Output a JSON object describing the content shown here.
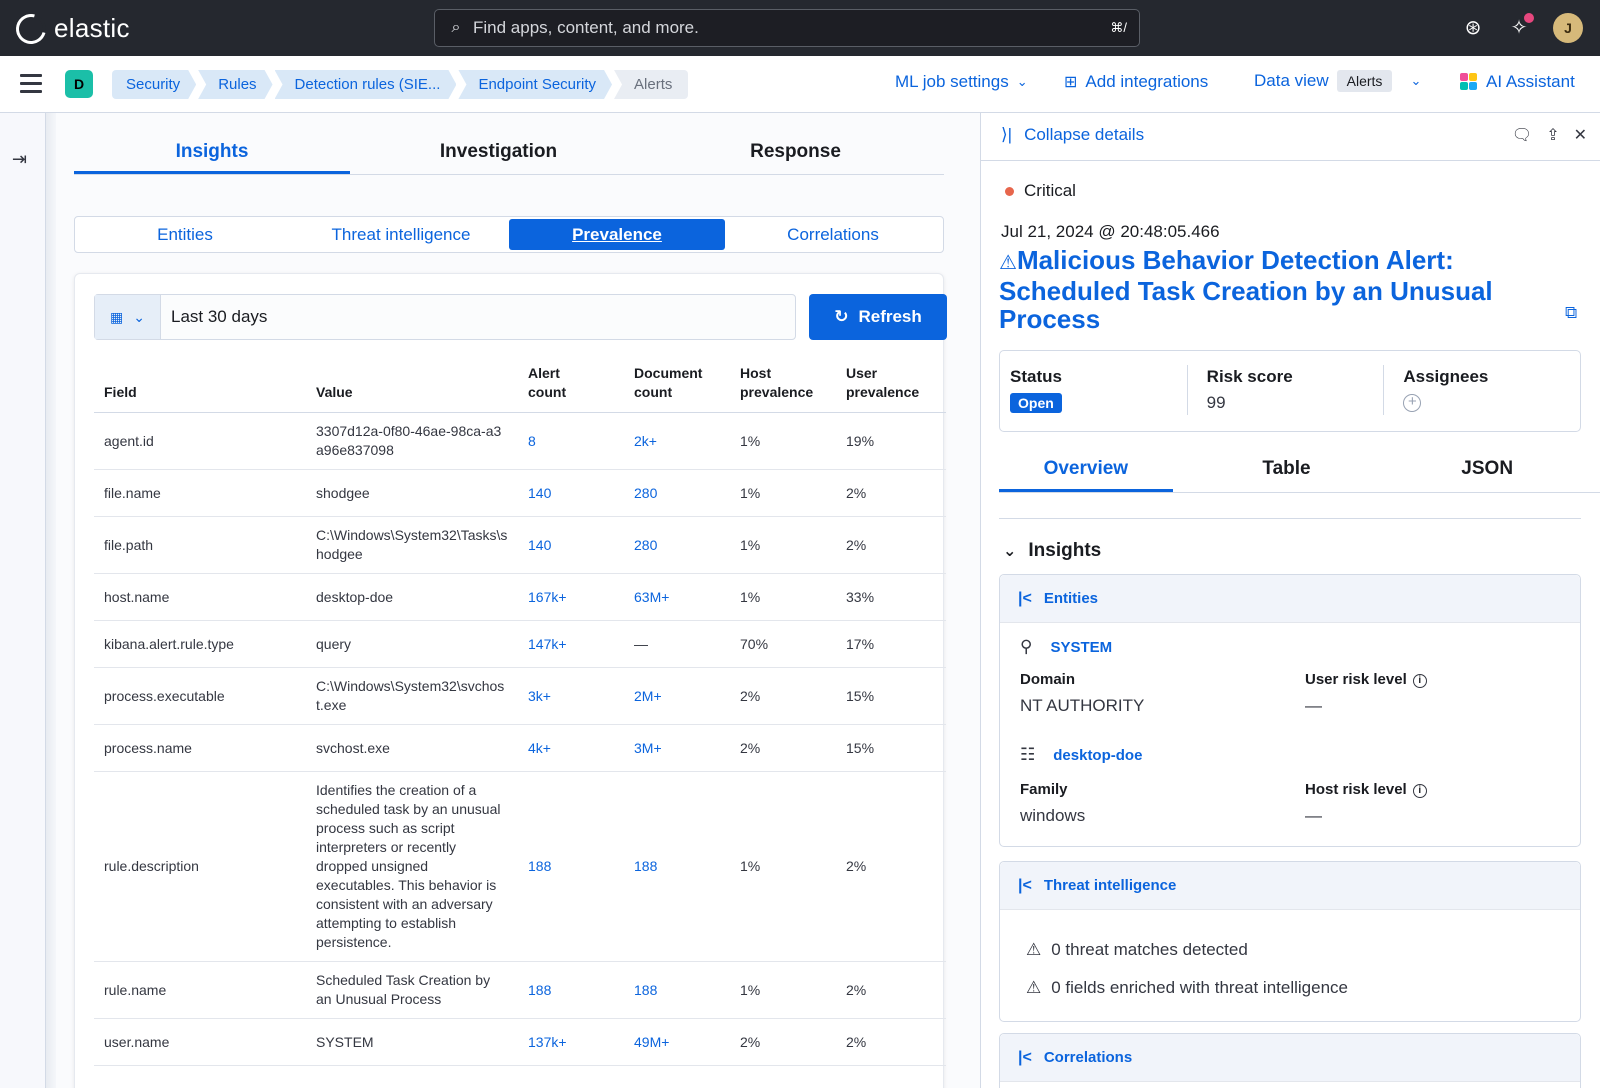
{
  "app": {
    "name": "elastic"
  },
  "search": {
    "placeholder": "Find apps, content, and more.",
    "shortcut": "⌘/"
  },
  "user": {
    "initial": "J"
  },
  "space": {
    "initial": "D"
  },
  "breadcrumbs": [
    "Security",
    "Rules",
    "Detection rules (SIE...",
    "Endpoint Security",
    "Alerts"
  ],
  "header": {
    "ml_job_settings": "ML job settings",
    "add_integrations": "Add integrations",
    "data_view_label": "Data view",
    "data_view_value": "Alerts",
    "ai_assistant": "AI Assistant"
  },
  "main_tabs": [
    "Insights",
    "Investigation",
    "Response"
  ],
  "sub_tabs": [
    "Entities",
    "Threat intelligence",
    "Prevalence",
    "Correlations"
  ],
  "datepicker": {
    "value": "Last 30 days"
  },
  "refresh_label": "Refresh",
  "table": {
    "headers": [
      "Field",
      "Value",
      "Alert count",
      "Document count",
      "Host prevalence",
      "User prevalence"
    ],
    "rows": [
      [
        "agent.id",
        "3307d12a-0f80-46ae-98ca-a3a96e837098",
        "8",
        "2k+",
        "1%",
        "19%"
      ],
      [
        "file.name",
        "shodgee",
        "140",
        "280",
        "1%",
        "2%"
      ],
      [
        "file.path",
        "C:\\Windows\\System32\\Tasks\\shodgee",
        "140",
        "280",
        "1%",
        "2%"
      ],
      [
        "host.name",
        "desktop-doe",
        "167k+",
        "63M+",
        "1%",
        "33%"
      ],
      [
        "kibana.alert.rule.type",
        "query",
        "147k+",
        "—",
        "70%",
        "17%"
      ],
      [
        "process.executable",
        "C:\\Windows\\System32\\svchost.exe",
        "3k+",
        "2M+",
        "2%",
        "15%"
      ],
      [
        "process.name",
        "svchost.exe",
        "4k+",
        "3M+",
        "2%",
        "15%"
      ],
      [
        "rule.description",
        "Identifies the creation of a scheduled task by an unusual process such as script interpreters or recently dropped unsigned executables. This behavior is consistent with an adversary attempting to establish persistence.",
        "188",
        "188",
        "1%",
        "2%"
      ],
      [
        "rule.name",
        "Scheduled Task Creation by an Unusual Process",
        "188",
        "188",
        "1%",
        "2%"
      ],
      [
        "user.name",
        "SYSTEM",
        "137k+",
        "49M+",
        "2%",
        "2%"
      ]
    ]
  },
  "flyout": {
    "collapse_label": "Collapse details",
    "severity": "Critical",
    "timestamp": "Jul 21, 2024 @ 20:48:05.466",
    "title": "Malicious Behavior Detection Alert: Scheduled Task Creation by an Unusual Process",
    "status_label": "Status",
    "status_value": "Open",
    "risk_label": "Risk score",
    "risk_value": "99",
    "assignees_label": "Assignees",
    "tabs": [
      "Overview",
      "Table",
      "JSON"
    ],
    "insights_label": "Insights",
    "entities": {
      "title": "Entities",
      "user_name": "SYSTEM",
      "domain_label": "Domain",
      "domain_value": "NT AUTHORITY",
      "user_risk_label": "User risk level",
      "user_risk_value": "—",
      "host_name": "desktop-doe",
      "family_label": "Family",
      "family_value": "windows",
      "host_risk_label": "Host risk level",
      "host_risk_value": "—"
    },
    "threat_intel": {
      "title": "Threat intelligence",
      "matches": "0 threat matches detected",
      "enriched": "0 fields enriched with threat intelligence"
    },
    "correlations": {
      "title": "Correlations"
    }
  },
  "colors": {
    "accent": "#0b64dd",
    "topbar": "#25282f",
    "critical": "#e7664c"
  }
}
